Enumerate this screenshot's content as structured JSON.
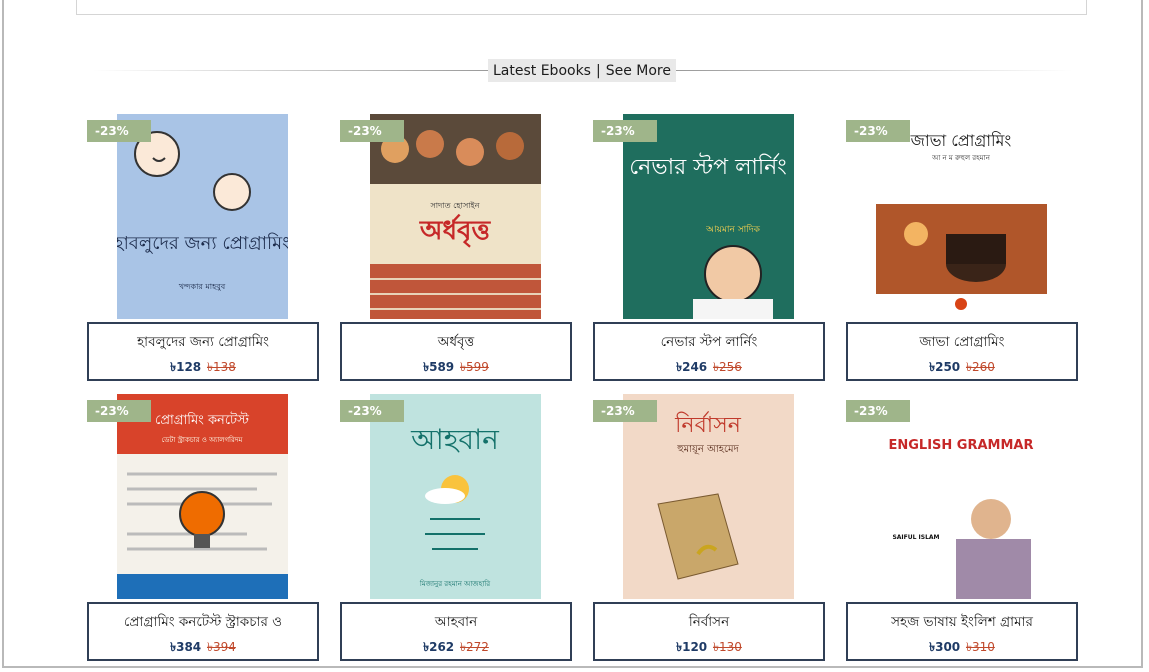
{
  "section": {
    "heading": "Latest Ebooks",
    "separator": "|",
    "see_more": "See More"
  },
  "colors": {
    "badge": "#9fb58a",
    "card_border": "#303f56",
    "price_now": "#1f3b66",
    "price_old": "#c0492c"
  },
  "books": [
    {
      "title": "হাবলুদের জন্য প্রোগ্রামিং",
      "badge": "-23%",
      "price": "৳128",
      "old_price": "৳138",
      "cover_icon": "book-cover-illustration"
    },
    {
      "title": "অর্ধবৃত্ত",
      "badge": "-23%",
      "price": "৳589",
      "old_price": "৳599",
      "cover_icon": "book-cover-illustration"
    },
    {
      "title": "নেভার স্টপ লার্নিং",
      "badge": "-23%",
      "price": "৳246",
      "old_price": "৳256",
      "cover_icon": "book-cover-illustration"
    },
    {
      "title": "জাভা প্রোগ্রামিং",
      "badge": "-23%",
      "price": "৳250",
      "old_price": "৳260",
      "cover_icon": "book-cover-illustration"
    },
    {
      "title": "প্রোগ্রামিং কনটেস্ট স্ট্রাকচার ও",
      "badge": "-23%",
      "price": "৳384",
      "old_price": "৳394",
      "cover_icon": "book-cover-illustration"
    },
    {
      "title": "আহবান",
      "badge": "-23%",
      "price": "৳262",
      "old_price": "৳272",
      "cover_icon": "book-cover-illustration"
    },
    {
      "title": "নির্বাসন",
      "badge": "-23%",
      "price": "৳120",
      "old_price": "৳130",
      "cover_icon": "book-cover-illustration"
    },
    {
      "title": "সহজ ভাষায় ইংলিশ গ্রামার",
      "badge": "-23%",
      "price": "৳300",
      "old_price": "৳310",
      "cover_icon": "book-cover-illustration"
    }
  ],
  "covers": [
    {
      "text": "হাবলুদের জন্য প্রোগ্রামিং",
      "sub": "খন্দকার মাহবুব"
    },
    {
      "text": "অর্ধবৃত্ত",
      "sub": "সাদাত হোসাইন"
    },
    {
      "text": "নেভার স্টপ লার্নিং",
      "sub": "আয়মান সাদিক"
    },
    {
      "text": "জাভা প্রোগ্রামিং",
      "sub": "আ ন ম রুহুল রহমান"
    },
    {
      "text": "প্রোগ্রামিং কনটেস্ট",
      "sub": "ডেটা স্ট্রাকচার ও অ্যালগরিদম"
    },
    {
      "text": "আহবান",
      "sub": "মিজানুর রহমান আজহারি"
    },
    {
      "text": "নির্বাসন",
      "sub": "হুমায়ূন আহমেদ"
    },
    {
      "text": "ENGLISH GRAMMAR",
      "sub": "SAIFUL ISLAM"
    }
  ]
}
